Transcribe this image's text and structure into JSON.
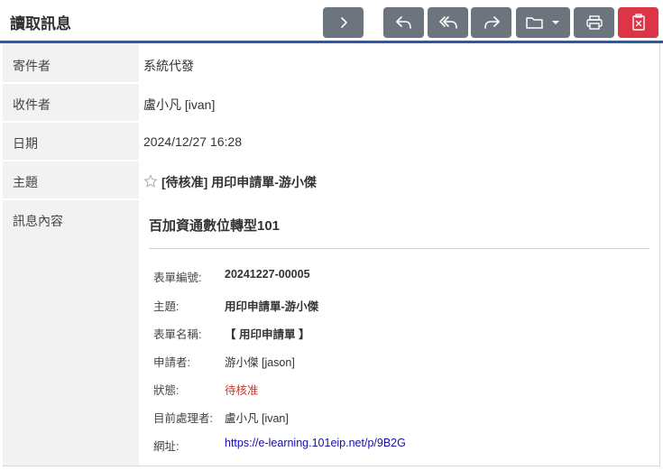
{
  "header": {
    "title": "讀取訊息",
    "buttons": [
      {
        "name": "next-button",
        "icon": "chevron-right-icon"
      },
      {
        "name": "reply-button",
        "icon": "reply-icon"
      },
      {
        "name": "reply-all-button",
        "icon": "reply-all-icon"
      },
      {
        "name": "forward-button",
        "icon": "forward-icon"
      },
      {
        "name": "move-folder-button",
        "icon": "folder-icon"
      },
      {
        "name": "print-button",
        "icon": "printer-icon"
      },
      {
        "name": "delete-button",
        "icon": "delete-icon"
      }
    ],
    "colors": {
      "button": "#6c757d",
      "danger": "#dc3545",
      "accent_line": "#2d58a7"
    }
  },
  "rows": {
    "sender_label": "寄件者",
    "sender": "系統代發",
    "recipient_label": "收件者",
    "recipient": "盧小凡 [ivan]",
    "date_label": "日期",
    "date": "2024/12/27 16:28",
    "subject_label": "主題",
    "subject": "[待核准] 用印申請單-游小傑",
    "content_label": "訊息內容"
  },
  "message": {
    "title": "百加資通數位轉型101",
    "fields": {
      "form_no_label": "表單編號:",
      "form_no": "20241227-00005",
      "subject_label": "主題:",
      "subject": "用印申請單-游小傑",
      "form_name_label": "表單名稱:",
      "form_name": "【 用印申請單 】",
      "applicant_label": "申請者:",
      "applicant": "游小傑 [jason]",
      "status_label": "狀態:",
      "status": "待核准",
      "handler_label": "目前處理者:",
      "handler": "盧小凡 [ivan]",
      "url_label": "網址:",
      "url": "https://e-learning.101eip.net/p/9B2G"
    }
  }
}
